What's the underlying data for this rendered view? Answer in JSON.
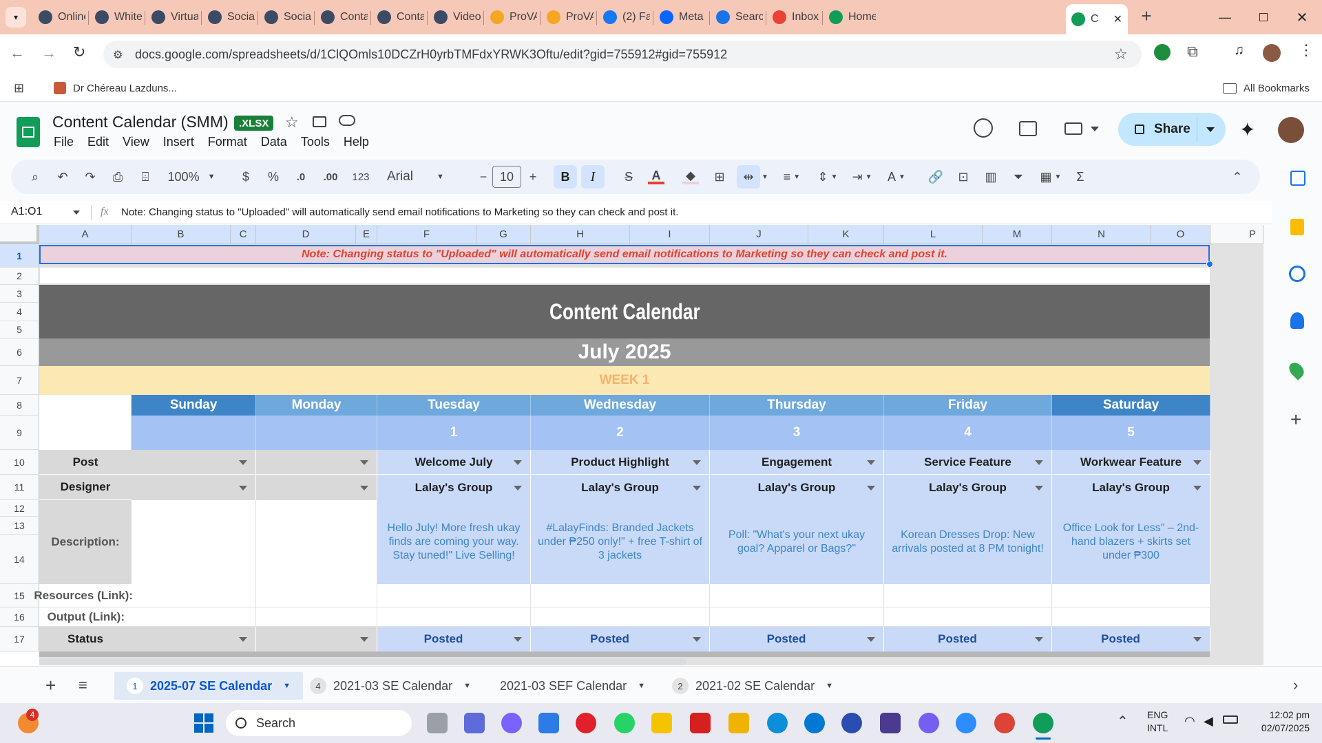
{
  "browser": {
    "tabs": [
      {
        "label": "Online",
        "active": false
      },
      {
        "label": "White",
        "active": false
      },
      {
        "label": "Virtua",
        "active": false
      },
      {
        "label": "Social",
        "active": false
      },
      {
        "label": "Social",
        "active": false
      },
      {
        "label": "Conta",
        "active": false
      },
      {
        "label": "Conta",
        "active": false
      },
      {
        "label": "Video",
        "active": false
      },
      {
        "label": "ProVA",
        "active": false
      },
      {
        "label": "ProVA",
        "active": false
      },
      {
        "label": "(2) Fa",
        "active": false
      },
      {
        "label": "Meta",
        "active": false
      },
      {
        "label": "Searc",
        "active": false
      },
      {
        "label": "Inbox",
        "active": false
      },
      {
        "label": "Home",
        "active": false
      },
      {
        "label": "C",
        "active": true
      }
    ],
    "url": "docs.google.com/spreadsheets/d/1ClQOmls10DCZrH0yrbTMFdxYRWK3Oftu/edit?gid=755912#gid=755912",
    "bookmark": "Dr Chéreau Lazduns...",
    "all_bookmarks": "All Bookmarks"
  },
  "doc": {
    "title": "Content Calendar (SMM)",
    "badge": ".XLSX",
    "menu": [
      "File",
      "Edit",
      "View",
      "Insert",
      "Format",
      "Data",
      "Tools",
      "Help"
    ],
    "share_label": "Share"
  },
  "toolbar": {
    "zoom": "100%",
    "currency": "$",
    "percent": "%",
    "dec_decrease": ".0",
    "dec_increase": ".00",
    "format_123": "123",
    "font": "Arial",
    "font_size": "10",
    "bold": "B",
    "italic": "I"
  },
  "formula_bar": {
    "cell_ref": "A1:O1",
    "fx": "fx",
    "content": "Note: Changing status to \"Uploaded\" will automatically send email notifications to Marketing so they can check and post it."
  },
  "grid": {
    "columns": [
      "A",
      "B",
      "C",
      "D",
      "E",
      "F",
      "G",
      "H",
      "I",
      "J",
      "K",
      "L",
      "M",
      "N",
      "O",
      "P"
    ],
    "rows": [
      "1",
      "2",
      "3",
      "4",
      "5",
      "6",
      "7",
      "8",
      "9",
      "10",
      "11",
      "12",
      "13",
      "14",
      "15",
      "16",
      "17"
    ],
    "note": "Note: Changing status to \"Uploaded\" will automatically send email notifications to Marketing so they can check and post it.",
    "title": "Content Calendar",
    "month": "July 2025",
    "week": "WEEK 1",
    "days": [
      "Sunday",
      "Monday",
      "Tuesday",
      "Wednesday",
      "Thursday",
      "Friday",
      "Saturday"
    ],
    "dates": [
      "",
      "",
      "1",
      "2",
      "3",
      "4",
      "5"
    ],
    "row_labels": {
      "post": "Post",
      "designer": "Designer",
      "description": "Description:",
      "resources": "Resources (Link):",
      "output": "Output (Link):",
      "status": "Status"
    },
    "posts": [
      "",
      "",
      "Welcome July",
      "Product Highlight",
      "Engagement",
      "Service Feature",
      "Workwear Feature"
    ],
    "designers": [
      "",
      "",
      "Lalay's Group",
      "Lalay's Group",
      "Lalay's Group",
      "Lalay's Group",
      "Lalay's Group"
    ],
    "descriptions": [
      "",
      "",
      "Hello July! More fresh ukay finds are coming your way. Stay tuned!\" Live Selling!",
      "#LalayFinds: Branded Jackets under ₱250 only!\" + free T-shirt of 3 jackets",
      "Poll: \"What's your next ukay goal? Apparel or Bags?\"",
      "Korean Dresses Drop: New arrivals posted at 8 PM tonight!",
      "Office Look for Less\" – 2nd-hand blazers + skirts set under ₱300"
    ],
    "statuses": [
      "",
      "",
      "Posted",
      "Posted",
      "Posted",
      "Posted",
      "Posted"
    ]
  },
  "sheet_tabs": [
    {
      "num": "1",
      "label": "2025-07 SE Calendar",
      "active": true
    },
    {
      "num": "4",
      "label": "2021-03 SE Calendar",
      "active": false
    },
    {
      "num": "",
      "label": "2021-03 SEF Calendar",
      "active": false
    },
    {
      "num": "2",
      "label": "2021-02 SE Calendar",
      "active": false
    }
  ],
  "taskbar": {
    "search": "Search",
    "lang1": "ENG",
    "lang2": "INTL",
    "time": "12:02 pm",
    "date": "02/07/2025",
    "badge": "4"
  },
  "colors": {
    "tabstrip": "#f6c8b8",
    "note_bg": "#ead1dc",
    "note_text": "#e0442f",
    "title_bg": "#666666",
    "month_bg": "#999999",
    "week_bg": "#fce8b2",
    "week_text": "#f6b26b",
    "day_dark": "#3d85c6",
    "day_light": "#6fa8dc",
    "cell_blue": "#c9daf8",
    "label_grey": "#d9d9d9"
  }
}
